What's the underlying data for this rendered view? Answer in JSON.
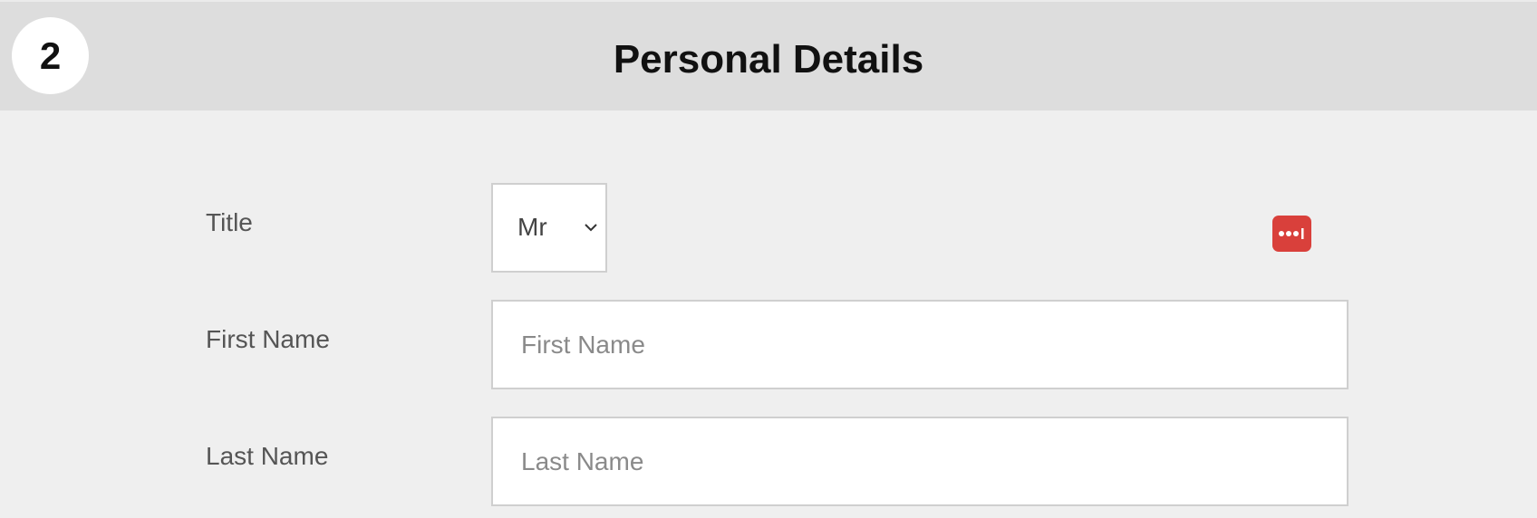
{
  "header": {
    "step_number": "2",
    "title": "Personal Details"
  },
  "form": {
    "title_field": {
      "label": "Title",
      "selected_value": "Mr"
    },
    "first_name_field": {
      "label": "First Name",
      "placeholder": "First Name",
      "value": ""
    },
    "last_name_field": {
      "label": "Last Name",
      "placeholder": "Last Name",
      "value": ""
    }
  },
  "icons": {
    "password_manager": "password-manager-icon",
    "select_arrow": "chevron-down-icon"
  },
  "colors": {
    "header_background": "#dddddd",
    "page_background": "#efefef",
    "password_manager_accent": "#d9403b"
  }
}
